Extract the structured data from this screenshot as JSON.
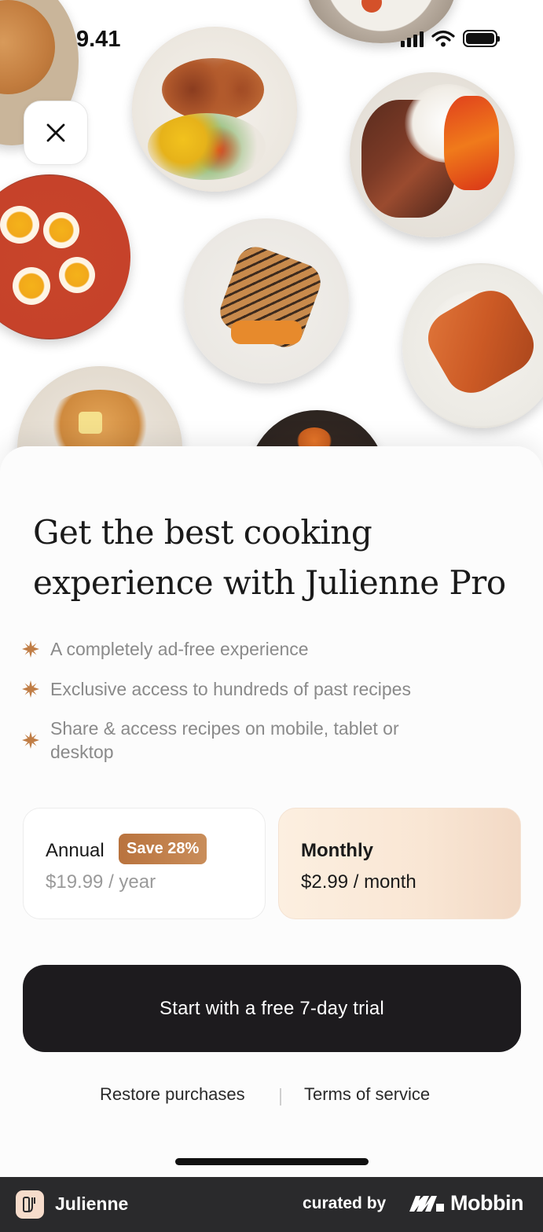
{
  "status_bar": {
    "time": "9.41"
  },
  "hero": {
    "close_label": "close"
  },
  "headline": "Get the best cooking experience with Julienne Pro",
  "features": [
    "A completely ad-free experience",
    "Exclusive access to hundreds of past recipes",
    "Share & access recipes on mobile, tablet or desktop"
  ],
  "plans": {
    "annual": {
      "name": "Annual",
      "badge": "Save 28%",
      "price": "$19.99 / year"
    },
    "monthly": {
      "name": "Monthly",
      "price": "$2.99 / month",
      "selected": true
    }
  },
  "cta_label": "Start with a free 7-day trial",
  "links": {
    "restore": "Restore purchases",
    "terms": "Terms of service"
  },
  "footer": {
    "app_name": "Julienne",
    "curated_by": "curated by",
    "brand": "Mobbin"
  },
  "colors": {
    "accent": "#c07d45",
    "cta_bg": "#1d1b1e",
    "footer_bg": "#2a2a2c"
  }
}
